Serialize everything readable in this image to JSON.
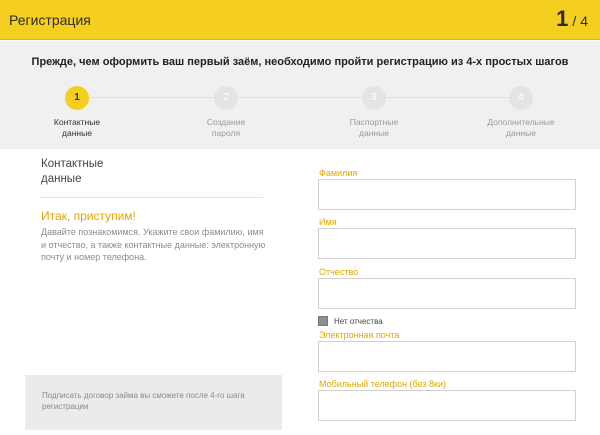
{
  "header": {
    "title": "Регистрация",
    "step_current": "1",
    "step_total": "/ 4",
    "accent": "#f5cf1f"
  },
  "intro": "Прежде, чем оформить ваш первый заём, необходимо пройти регистрацию из 4-х простых шагов",
  "steps": [
    {
      "number": "1",
      "label_line1": "Контактные",
      "label_line2": "данные",
      "active": true
    },
    {
      "number": "2",
      "label_line1": "Создание",
      "label_line2": "пароля",
      "active": false
    },
    {
      "number": "3",
      "label_line1": "Паспортные",
      "label_line2": "данные",
      "active": false
    },
    {
      "number": "4",
      "label_line1": "Дополнительные",
      "label_line2": "данные",
      "active": false
    }
  ],
  "left": {
    "title_line1": "Контактные",
    "title_line2": "данные",
    "welcome": "Итак, приступим!",
    "welcome_text": "Давайте познакомимся. Укажите свои фамилию, имя и отчество, а также контактные данные: электронную почту и номер телефона.",
    "note": "Подписать договор займа вы сможете после 4-го шага регистрации"
  },
  "form": {
    "last_name_label": "Фамилия",
    "last_name_value": "",
    "first_name_label": "Имя",
    "first_name_value": "",
    "middle_name_label": "Отчество",
    "middle_name_value": "",
    "no_middle_name_label": "Нет отчества",
    "email_label": "Электронная почта",
    "email_value": "",
    "phone_label": "Мобильный телефон (без 8ки)",
    "phone_value": ""
  }
}
